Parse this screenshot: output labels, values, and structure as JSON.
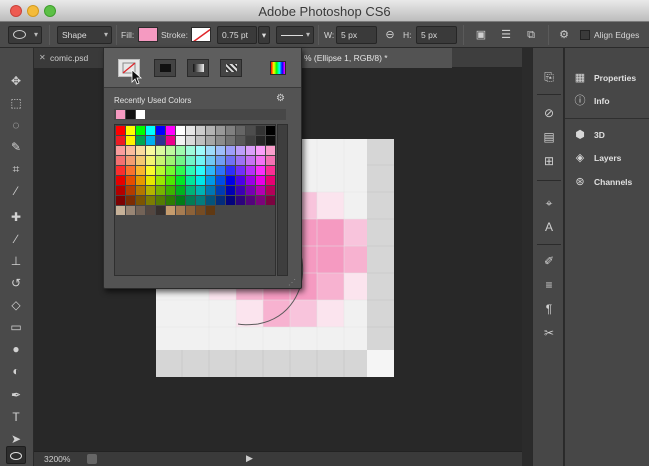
{
  "window": {
    "title": "Adobe Photoshop CS6"
  },
  "options_bar": {
    "tool_mode": "Shape",
    "fill_label": "Fill:",
    "fill_color": "#f59ac1",
    "stroke_label": "Stroke:",
    "stroke_width": "0.75 pt",
    "w_label": "W:",
    "w_value": "5 px",
    "h_label": "H:",
    "h_value": "5 px",
    "align_edges": "Align Edges",
    "align_edges_checked": false
  },
  "tabs": [
    {
      "label": "comic.psd"
    },
    {
      "label": "% (Ellipse 1, RGB/8) *"
    }
  ],
  "status": {
    "zoom": "3200%"
  },
  "popup": {
    "recent_label": "Recently Used Colors",
    "recent_colors": [
      "#f59ac1",
      "#111111",
      "#ffffff"
    ]
  },
  "panels": [
    {
      "label": "Properties",
      "icon": "sliders-icon"
    },
    {
      "label": "Info",
      "icon": "info-icon"
    },
    {
      "label": "3D",
      "icon": "cube-icon"
    },
    {
      "label": "Layers",
      "icon": "layers-icon"
    },
    {
      "label": "Channels",
      "icon": "channels-icon"
    }
  ],
  "colors": {
    "pink": "#f59ac1",
    "pink_light": "#f8c4dc",
    "canvas_bg": "#282828",
    "panel_bg": "#474747"
  }
}
